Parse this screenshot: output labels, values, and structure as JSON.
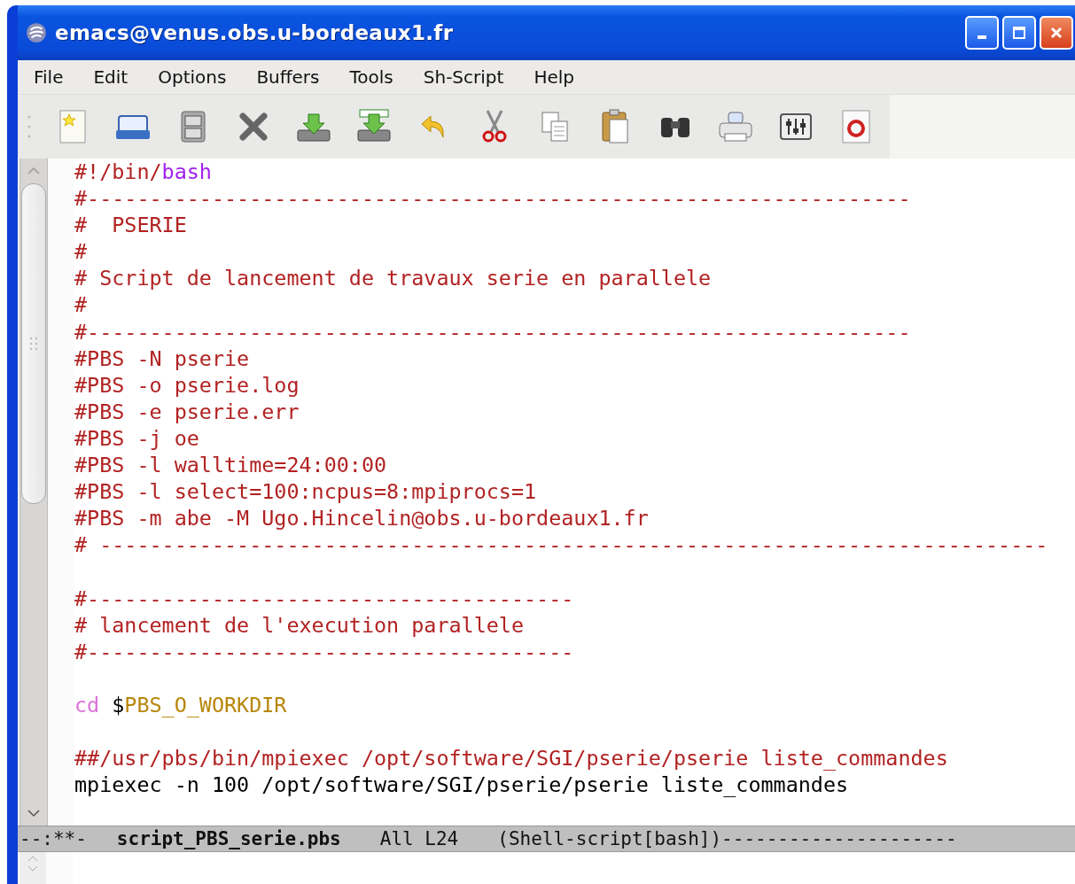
{
  "window": {
    "title": "emacs@venus.obs.u-bordeaux1.fr"
  },
  "menu": [
    "File",
    "Edit",
    "Options",
    "Buffers",
    "Tools",
    "Sh-Script",
    "Help"
  ],
  "toolbar": [
    {
      "kind": "new"
    },
    {
      "kind": "open"
    },
    {
      "kind": "save"
    },
    {
      "kind": "close"
    },
    {
      "kind": "insert"
    },
    {
      "kind": "saveas"
    },
    {
      "kind": "undo"
    },
    {
      "kind": "cut"
    },
    {
      "kind": "copy"
    },
    {
      "kind": "paste"
    },
    {
      "kind": "find"
    },
    {
      "kind": "print"
    },
    {
      "kind": "customize"
    },
    {
      "kind": "help"
    }
  ],
  "buffer": {
    "lines": [
      {
        "kind": "code",
        "segments": [
          {
            "text": "#!/bin/",
            "kind": "comment"
          },
          {
            "text": "bash",
            "kind": "keyword"
          }
        ]
      },
      {
        "kind": "code",
        "segments": [
          {
            "text": "#------------------------------------------------------------------",
            "kind": "comment"
          }
        ]
      },
      {
        "kind": "code",
        "segments": [
          {
            "text": "#  PSERIE",
            "kind": "comment"
          }
        ]
      },
      {
        "kind": "code",
        "segments": [
          {
            "text": "#",
            "kind": "comment"
          }
        ]
      },
      {
        "kind": "code",
        "segments": [
          {
            "text": "# Script de lancement de travaux serie en parallele",
            "kind": "comment"
          }
        ]
      },
      {
        "kind": "code",
        "segments": [
          {
            "text": "#",
            "kind": "comment"
          }
        ]
      },
      {
        "kind": "code",
        "segments": [
          {
            "text": "#------------------------------------------------------------------",
            "kind": "comment"
          }
        ]
      },
      {
        "kind": "code",
        "segments": [
          {
            "text": "#PBS -N pserie",
            "kind": "comment"
          }
        ]
      },
      {
        "kind": "code",
        "segments": [
          {
            "text": "#PBS -o pserie.log",
            "kind": "comment"
          }
        ]
      },
      {
        "kind": "code",
        "segments": [
          {
            "text": "#PBS -e pserie.err",
            "kind": "comment"
          }
        ]
      },
      {
        "kind": "code",
        "segments": [
          {
            "text": "#PBS -j oe",
            "kind": "comment"
          }
        ]
      },
      {
        "kind": "code",
        "segments": [
          {
            "text": "#PBS -l walltime=24:00:00",
            "kind": "comment"
          }
        ]
      },
      {
        "kind": "code",
        "segments": [
          {
            "text": "#PBS -l select=100:ncpus=8:mpiprocs=1",
            "kind": "comment"
          }
        ]
      },
      {
        "kind": "code",
        "segments": [
          {
            "text": "#PBS -m abe -M Ugo.Hincelin@obs.u-bordeaux1.fr",
            "kind": "comment"
          }
        ]
      },
      {
        "kind": "code",
        "segments": [
          {
            "text": "# ----------------------------------------------------------------------------",
            "kind": "comment"
          }
        ]
      },
      {
        "kind": "blank"
      },
      {
        "kind": "code",
        "segments": [
          {
            "text": "#---------------------------------------",
            "kind": "comment"
          }
        ]
      },
      {
        "kind": "code",
        "segments": [
          {
            "text": "# lancement de l'execution parallele",
            "kind": "comment"
          }
        ]
      },
      {
        "kind": "code",
        "segments": [
          {
            "text": "#---------------------------------------",
            "kind": "comment"
          }
        ]
      },
      {
        "kind": "blank"
      },
      {
        "kind": "code",
        "segments": [
          {
            "text": "cd",
            "kind": "builtin"
          },
          {
            "text": " $",
            "kind": "plain"
          },
          {
            "text": "PBS_O_WORKDIR",
            "kind": "variable"
          }
        ]
      },
      {
        "kind": "blank"
      },
      {
        "kind": "code",
        "segments": [
          {
            "text": "##/usr/pbs/bin/mpiexec /opt/software/SGI/pserie/pserie liste_commandes",
            "kind": "comment"
          }
        ]
      },
      {
        "kind": "code",
        "segments": [
          {
            "text": "mpiexec -n 100 /opt/software/SGI/pserie/pserie liste_commandes",
            "kind": "plain"
          }
        ]
      }
    ]
  },
  "mode_line": {
    "status": "--:**-",
    "buffer_name": "script_PBS_serie.pbs",
    "position": "All L24",
    "mode": "(Shell-script[bash])---------------------"
  }
}
